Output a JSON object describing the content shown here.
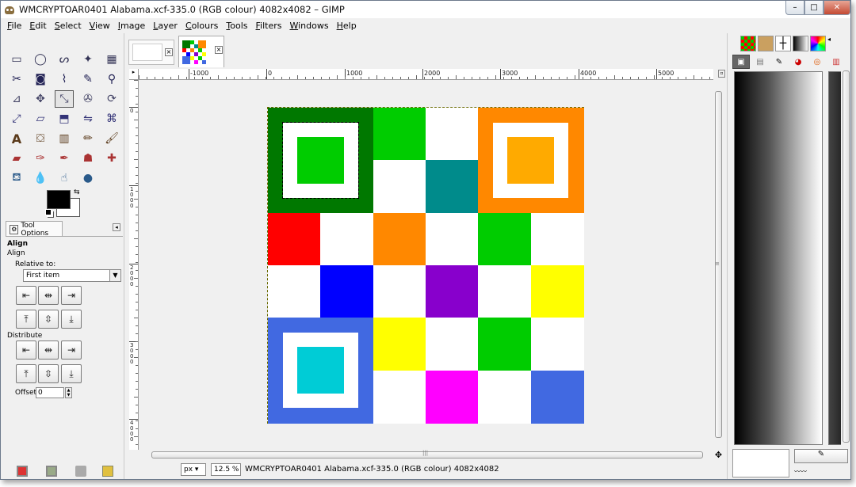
{
  "window": {
    "title": "WMCRYPTOAR0401 Alabama.xcf-335.0 (RGB colour) 4082x4082 – GIMP",
    "minimize_label": "–",
    "maximize_label": "□",
    "close_label": "✕"
  },
  "menubar": [
    {
      "mnemonic": "F",
      "rest": "ile"
    },
    {
      "mnemonic": "E",
      "rest": "dit"
    },
    {
      "mnemonic": "S",
      "rest": "elect"
    },
    {
      "mnemonic": "V",
      "rest": "iew"
    },
    {
      "mnemonic": "I",
      "rest": "mage"
    },
    {
      "mnemonic": "L",
      "rest": "ayer"
    },
    {
      "mnemonic": "C",
      "rest": "olours"
    },
    {
      "mnemonic": "T",
      "rest": "ools"
    },
    {
      "mnemonic": "F",
      "rest": "ilters"
    },
    {
      "mnemonic": "W",
      "rest": "indows"
    },
    {
      "mnemonic": "H",
      "rest": "elp"
    }
  ],
  "tool_options": {
    "tab_label": "Tool Options",
    "tool_name": "Align",
    "tool_subtitle": "Align",
    "relative_to_label": "Relative to:",
    "relative_to_value": "First item",
    "distribute_label": "Distribute",
    "offset_label": "Offset:",
    "offset_value": "0"
  },
  "ruler": {
    "h_labels": [
      "-1000",
      "0",
      "1000",
      "2000",
      "3000",
      "4000",
      "5000"
    ],
    "v_labels": [
      "0",
      "1000",
      "2000",
      "3000",
      "4000"
    ]
  },
  "statusbar": {
    "unit": "px",
    "zoom": "12.5 %",
    "text": "WMCRYPTOAR0401 Alabama.xcf-335.0 (RGB colour) 4082x4082"
  },
  "image": {
    "grid": [
      [
        "#007800",
        "#007800",
        "#00cc00",
        "#ffffff",
        "#ff8800",
        "#ff8800"
      ],
      [
        "#007800",
        "#007800",
        "#ffffff",
        "#008b8b",
        "#ff8800",
        "#ff8800"
      ],
      [
        "#ff0000",
        "#ffffff",
        "#ff8800",
        "#ffffff",
        "#00cc00",
        "#ffffff"
      ],
      [
        "#ffffff",
        "#0000ff",
        "#ffffff",
        "#8800cc",
        "#ffffff",
        "#ffff00"
      ],
      [
        "#4169e1",
        "#4169e1",
        "#ffff00",
        "#ffffff",
        "#00cc00",
        "#ffffff"
      ],
      [
        "#4169e1",
        "#4169e1",
        "#ffffff",
        "#ff00ff",
        "#ffffff",
        "#4169e1"
      ]
    ],
    "finder_inner": [
      "#00cc00",
      "#ffaa00",
      "#00ccd6"
    ]
  },
  "colors": {
    "foreground": "#000000",
    "background": "#ffffff"
  }
}
